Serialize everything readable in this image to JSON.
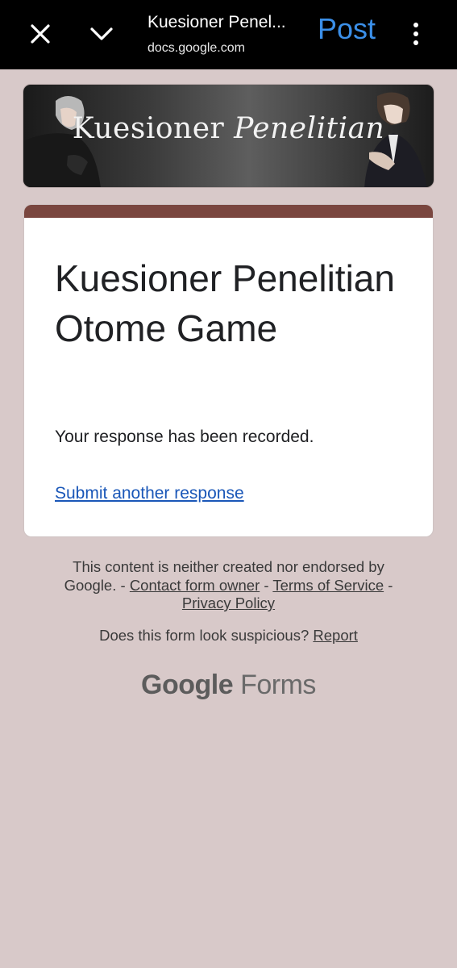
{
  "browser": {
    "title": "Kuesioner Penel...",
    "url": "docs.google.com",
    "post_label": "Post",
    "close_icon": "close-icon",
    "chevron_icon": "chevron-down-icon",
    "more_icon": "more-vert-icon"
  },
  "banner": {
    "title_main": "Kuesioner",
    "title_italic": "Penelitian"
  },
  "form": {
    "title": "Kuesioner Penelitian Otome Game",
    "confirmation": "Your response has been recorded.",
    "another_link": "Submit another response",
    "accent_color": "#7a463f"
  },
  "footer": {
    "disclaimer_prefix": "This content is neither created nor endorsed by Google. - ",
    "contact_link": "Contact form owner",
    "sep1": " - ",
    "terms_link": "Terms of Service",
    "sep2": " - ",
    "privacy_link": "Privacy Policy",
    "suspicious_text": "Does this form look suspicious? ",
    "report_link": "Report",
    "brand_google": "Google",
    "brand_forms": "Forms"
  }
}
